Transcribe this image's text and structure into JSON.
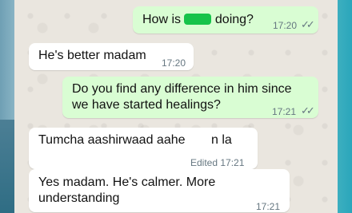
{
  "messages": [
    {
      "pre": "How is ",
      "post": " doing?",
      "time": "17:20",
      "ticks": "✓✓"
    },
    {
      "text": "He's better madam",
      "time": "17:20"
    },
    {
      "line1": "Do you find any difference in him since",
      "line2": "we have started healings?",
      "time": "17:21",
      "ticks": "✓✓"
    },
    {
      "pre": "Tumcha  aashirwaad aahe ",
      "post": "n la",
      "edited": "Edited 17:21"
    },
    {
      "line1": "Yes madam.  He's calmer.  More",
      "line2": "understanding",
      "time": "17:21"
    }
  ],
  "colors": {
    "outgoing": "#d9fdd3",
    "incoming": "#ffffff",
    "chat_bg": "#eae6df"
  }
}
